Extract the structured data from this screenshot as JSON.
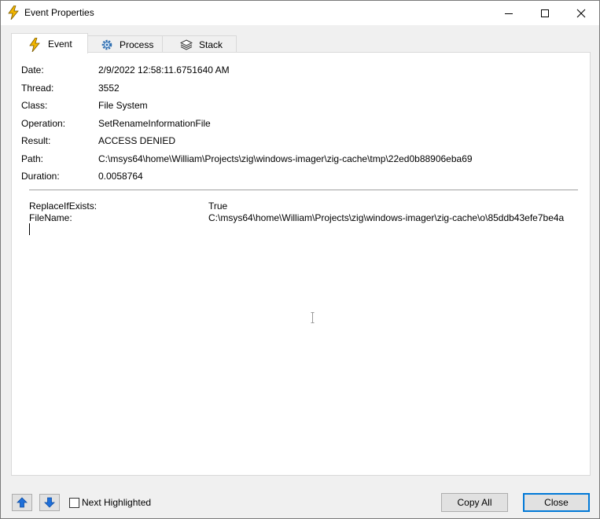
{
  "window": {
    "title": "Event Properties"
  },
  "tabs": [
    {
      "label": "Event",
      "icon": "lightning-icon",
      "active": true
    },
    {
      "label": "Process",
      "icon": "gear-icon",
      "active": false
    },
    {
      "label": "Stack",
      "icon": "layers-icon",
      "active": false
    }
  ],
  "properties": [
    {
      "label": "Date:",
      "value": "2/9/2022 12:58:11.6751640 AM"
    },
    {
      "label": "Thread:",
      "value": "3552"
    },
    {
      "label": "Class:",
      "value": "File System"
    },
    {
      "label": "Operation:",
      "value": "SetRenameInformationFile"
    },
    {
      "label": "Result:",
      "value": "ACCESS DENIED"
    },
    {
      "label": "Path:",
      "value": "C:\\msys64\\home\\William\\Projects\\zig\\windows-imager\\zig-cache\\tmp\\22ed0b88906eba69"
    },
    {
      "label": "Duration:",
      "value": "0.0058764"
    }
  ],
  "details": [
    {
      "label": "ReplaceIfExists:",
      "value": "True"
    },
    {
      "label": "FileName:",
      "value": "C:\\msys64\\home\\William\\Projects\\zig\\windows-imager\\zig-cache\\o\\85ddb43efe7be4a"
    }
  ],
  "footer": {
    "next_highlighted_label": "Next Highlighted",
    "next_highlighted_checked": false,
    "copy_all_label": "Copy All",
    "close_label": "Close"
  },
  "colors": {
    "accent": "#0078d7",
    "lightning": "#f2b600",
    "arrow": "#1e6fd9"
  }
}
